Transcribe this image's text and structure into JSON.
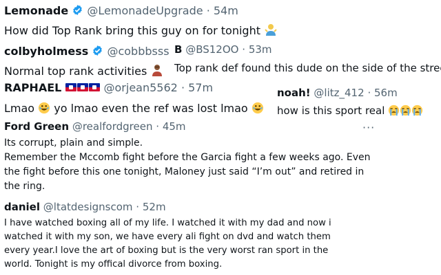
{
  "tweets": [
    {
      "name": "Lemonade",
      "handle": "@LemonadeUpgrade",
      "sep": "·",
      "time": "54m",
      "verified": true,
      "text": "How did Top Rank bring this guy on for tonight",
      "emoji": "person-shrugging"
    },
    {
      "name": "colbyholmess",
      "handle": "@cobbbsss",
      "sep": "·",
      "time": "53m",
      "verified": true,
      "text": "Normal top rank activities",
      "emoji": "person-facepalming"
    },
    {
      "name": "B",
      "handle": "@BS12OO",
      "sep": "·",
      "time": "53m",
      "verified": false,
      "text": "Top rank def found this dude on the side of the street"
    },
    {
      "name": "RAPHAEL",
      "handle": "@orjean5562",
      "sep": "·",
      "time": "57m",
      "verified": false,
      "flags": [
        "haiti-flag",
        "haiti-flag",
        "haiti-flag"
      ],
      "text_parts": [
        "Lmao",
        "yo lmao even the ref was lost lmao"
      ],
      "emoji": "rolling-on-floor-laughing"
    },
    {
      "name": "noah!",
      "handle": "@litz_412",
      "sep": "·",
      "time": "56m",
      "verified": false,
      "text": "how is this sport real",
      "emoji": "loudly-crying-face"
    },
    {
      "name": "Ford Green",
      "handle": "@realfordgreen",
      "sep": "·",
      "time": "45m",
      "verified": false,
      "more_label": "···",
      "lines": [
        "Its corrupt, plain and simple.",
        "Remember the Mccomb fight before the Garcia fight a few weeks ago. Even",
        "the fight before this one tonight, Maloney just said “I’m out” and retired in",
        "the ring."
      ]
    },
    {
      "name": "daniel",
      "handle": "@ltatdesignscom",
      "sep": "·",
      "time": "52m",
      "verified": false,
      "lines": [
        "I have watched boxing all of my life. I watched it with my dad and now i",
        "watched it with my son, we have every ali fight on dvd and watch them",
        "every year.I love the art of boxing but is the very worst ran sport in the",
        "world. Tonight is my offical divorce from boxing."
      ]
    }
  ],
  "colors": {
    "text": "#0f1419",
    "secondary": "#536471",
    "verified": "#1d9bf0",
    "background": "#ffffff"
  }
}
